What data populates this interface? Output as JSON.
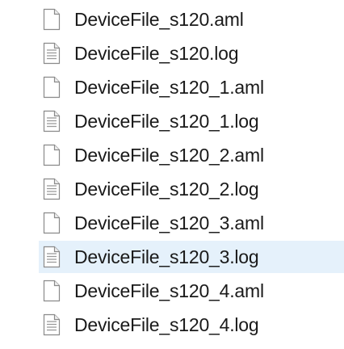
{
  "files": [
    {
      "name": "DeviceFile_s120.aml",
      "icon": "blank-file-icon",
      "hovered": false
    },
    {
      "name": "DeviceFile_s120.log",
      "icon": "text-file-icon",
      "hovered": false
    },
    {
      "name": "DeviceFile_s120_1.aml",
      "icon": "blank-file-icon",
      "hovered": false
    },
    {
      "name": "DeviceFile_s120_1.log",
      "icon": "text-file-icon",
      "hovered": false
    },
    {
      "name": "DeviceFile_s120_2.aml",
      "icon": "blank-file-icon",
      "hovered": false
    },
    {
      "name": "DeviceFile_s120_2.log",
      "icon": "text-file-icon",
      "hovered": false
    },
    {
      "name": "DeviceFile_s120_3.aml",
      "icon": "blank-file-icon",
      "hovered": false
    },
    {
      "name": "DeviceFile_s120_3.log",
      "icon": "text-file-icon",
      "hovered": true
    },
    {
      "name": "DeviceFile_s120_4.aml",
      "icon": "blank-file-icon",
      "hovered": false
    },
    {
      "name": "DeviceFile_s120_4.log",
      "icon": "text-file-icon",
      "hovered": false
    }
  ],
  "colors": {
    "hover_background": "#e5f1fb",
    "text": "#1a1a1a",
    "icon_outline": "#8a8a8a"
  }
}
